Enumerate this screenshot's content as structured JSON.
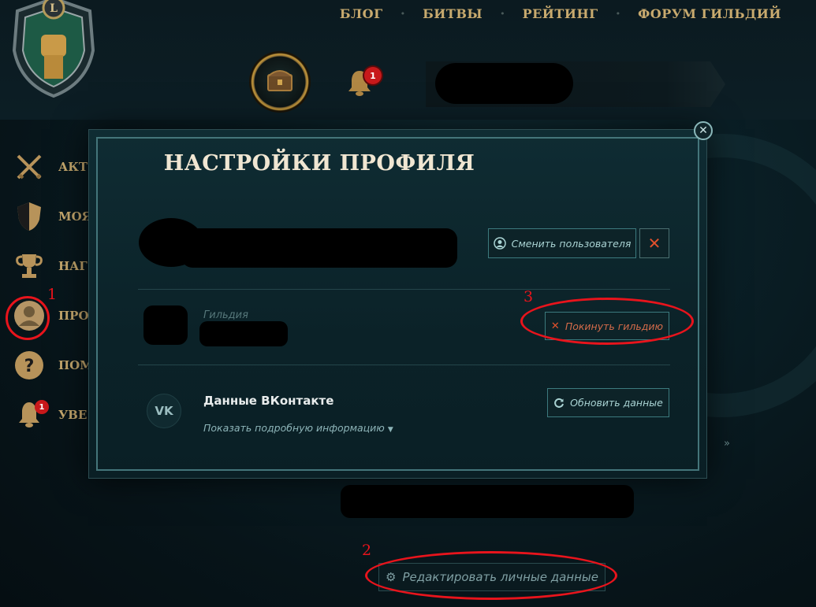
{
  "nav": {
    "items": [
      "БЛОГ",
      "БИТВЫ",
      "РЕЙТИНГ",
      "ФОРУМ ГИЛЬДИЙ"
    ],
    "separator": "•"
  },
  "header": {
    "notification_count": "1"
  },
  "sidebar": {
    "items": [
      {
        "label": "АКТ",
        "icon": "crossed-swords-icon"
      },
      {
        "label": "МОЯ",
        "icon": "shield-icon"
      },
      {
        "label": "НАГ",
        "icon": "trophy-icon"
      },
      {
        "label": "ПРО",
        "icon": "profile-icon"
      },
      {
        "label": "ПОМ",
        "icon": "help-icon"
      },
      {
        "label": "УВЕ",
        "icon": "bell-icon",
        "badge": "1"
      }
    ]
  },
  "modal": {
    "title": "НАСТРОЙКИ ПРОФИЛЯ",
    "close_symbol": "✕",
    "switch_user_label": "Сменить пользователя",
    "remove_symbol": "✕",
    "guild_label": "Гильдия",
    "leave_guild_label": "Покинуть гильдию",
    "vk_title": "Данные ВКонтакте",
    "vk_details_label": "Показать подробную информацию",
    "vk_icon_text": "VK",
    "refresh_label": "Обновить данные"
  },
  "edit_personal_label": "Редактировать личные данные",
  "side_chevron": "»",
  "annotations": [
    "1",
    "2",
    "3"
  ],
  "colors": {
    "gold": "#c8aa6e",
    "teal_border": "#3c7a7e",
    "annotation_red": "#e8141c",
    "danger": "#e2512c"
  }
}
